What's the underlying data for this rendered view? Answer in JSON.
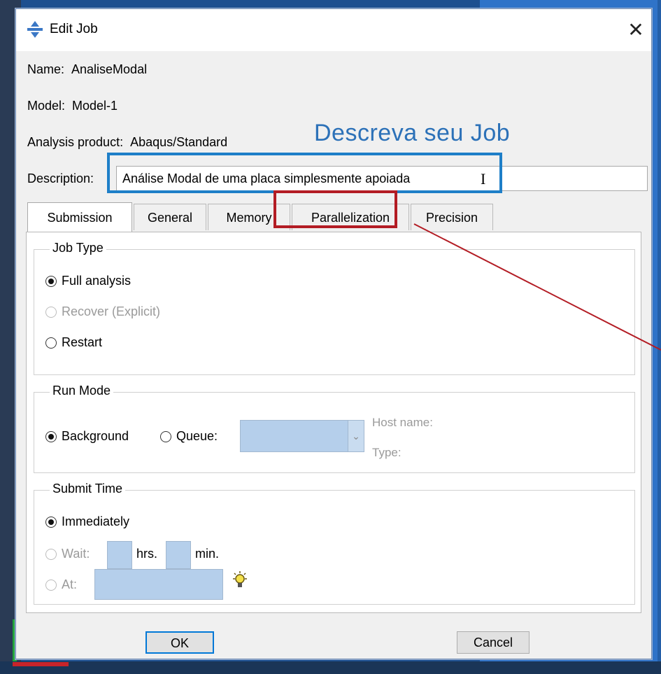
{
  "dialog": {
    "title": "Edit Job",
    "close_glyph": "✕"
  },
  "fields": {
    "name_label": "Name:",
    "name_value": "AnaliseModal",
    "model_label": "Model:",
    "model_value": "Model-1",
    "product_label": "Analysis product:",
    "product_value": "Abaqus/Standard",
    "description_label": "Description:",
    "description_value": "Análise Modal de uma placa simplesmente apoiada"
  },
  "annotation": {
    "text": "Descreva seu Job",
    "highlight_color": "#1e7fc8",
    "tab_highlight_color": "#b31c24"
  },
  "tabs": [
    {
      "label": "Submission",
      "active": true
    },
    {
      "label": "General",
      "active": false
    },
    {
      "label": "Memory",
      "active": false
    },
    {
      "label": "Parallelization",
      "active": false
    },
    {
      "label": "Precision",
      "active": false
    }
  ],
  "job_type": {
    "title": "Job Type",
    "options": [
      {
        "label": "Full analysis",
        "selected": true,
        "enabled": true
      },
      {
        "label": "Recover (Explicit)",
        "selected": false,
        "enabled": false
      },
      {
        "label": "Restart",
        "selected": false,
        "enabled": true
      }
    ]
  },
  "run_mode": {
    "title": "Run Mode",
    "background_label": "Background",
    "queue_label": "Queue:",
    "host_name_label": "Host name:",
    "type_label": "Type:",
    "selected": "Background"
  },
  "submit_time": {
    "title": "Submit Time",
    "immediately_label": "Immediately",
    "wait_label": "Wait:",
    "hrs_label": "hrs.",
    "min_label": "min.",
    "at_label": "At:",
    "selected": "Immediately"
  },
  "buttons": {
    "ok": "OK",
    "cancel": "Cancel"
  }
}
